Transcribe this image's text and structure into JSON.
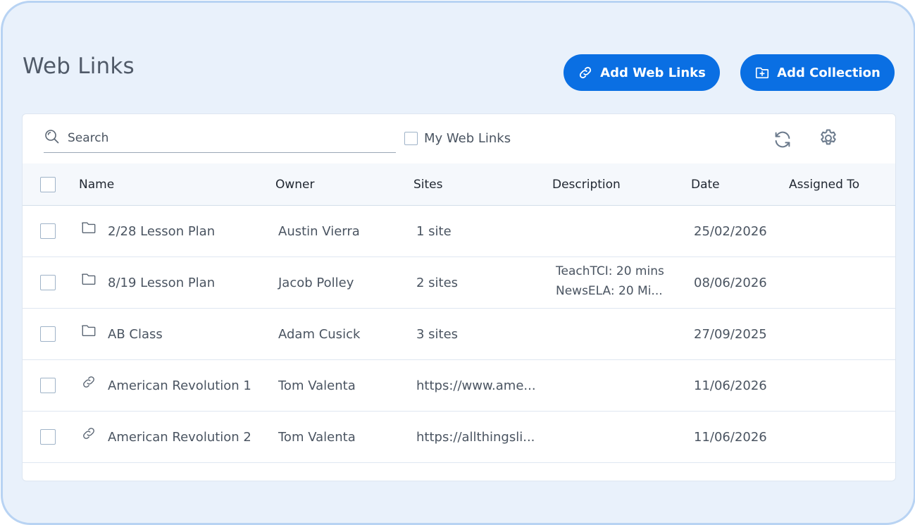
{
  "page": {
    "title": "Web Links"
  },
  "actions": {
    "add_web_links": "Add Web Links",
    "add_collection": "Add Collection"
  },
  "toolbar": {
    "search_placeholder": "Search",
    "my_web_links_label": "My Web Links",
    "my_web_links_checked": false
  },
  "table": {
    "columns": {
      "name": "Name",
      "owner": "Owner",
      "sites": "Sites",
      "description": "Description",
      "date": "Date",
      "assigned_to": "Assigned To"
    },
    "rows": [
      {
        "type": "folder-icon",
        "name": "2/28 Lesson Plan",
        "owner": "Austin Vierra",
        "sites": "1 site",
        "description_line1": "",
        "description_line2": "",
        "date": "25/02/2026",
        "assigned_to": ""
      },
      {
        "type": "folder-icon",
        "name": "8/19 Lesson Plan",
        "owner": "Jacob Polley",
        "sites": "2 sites",
        "description_line1": "TeachTCI: 20 mins",
        "description_line2": "NewsELA: 20 Mi...",
        "date": "08/06/2026",
        "assigned_to": ""
      },
      {
        "type": "folder-icon",
        "name": "AB Class",
        "owner": "Adam Cusick",
        "sites": "3 sites",
        "description_line1": "",
        "description_line2": "",
        "date": "27/09/2025",
        "assigned_to": ""
      },
      {
        "type": "link-icon",
        "name": "American Revolution 1",
        "owner": "Tom Valenta",
        "sites": "https://www.ame...",
        "description_line1": "",
        "description_line2": "",
        "date": "11/06/2026",
        "assigned_to": ""
      },
      {
        "type": "link-icon",
        "name": "American Revolution 2",
        "owner": "Tom Valenta",
        "sites": "https://allthingsli...",
        "description_line1": "",
        "description_line2": "",
        "date": "11/06/2026",
        "assigned_to": ""
      }
    ]
  },
  "colors": {
    "accent": "#0a6fe3",
    "background": "#e9f1fb",
    "frame_border": "#b8d3f3"
  }
}
